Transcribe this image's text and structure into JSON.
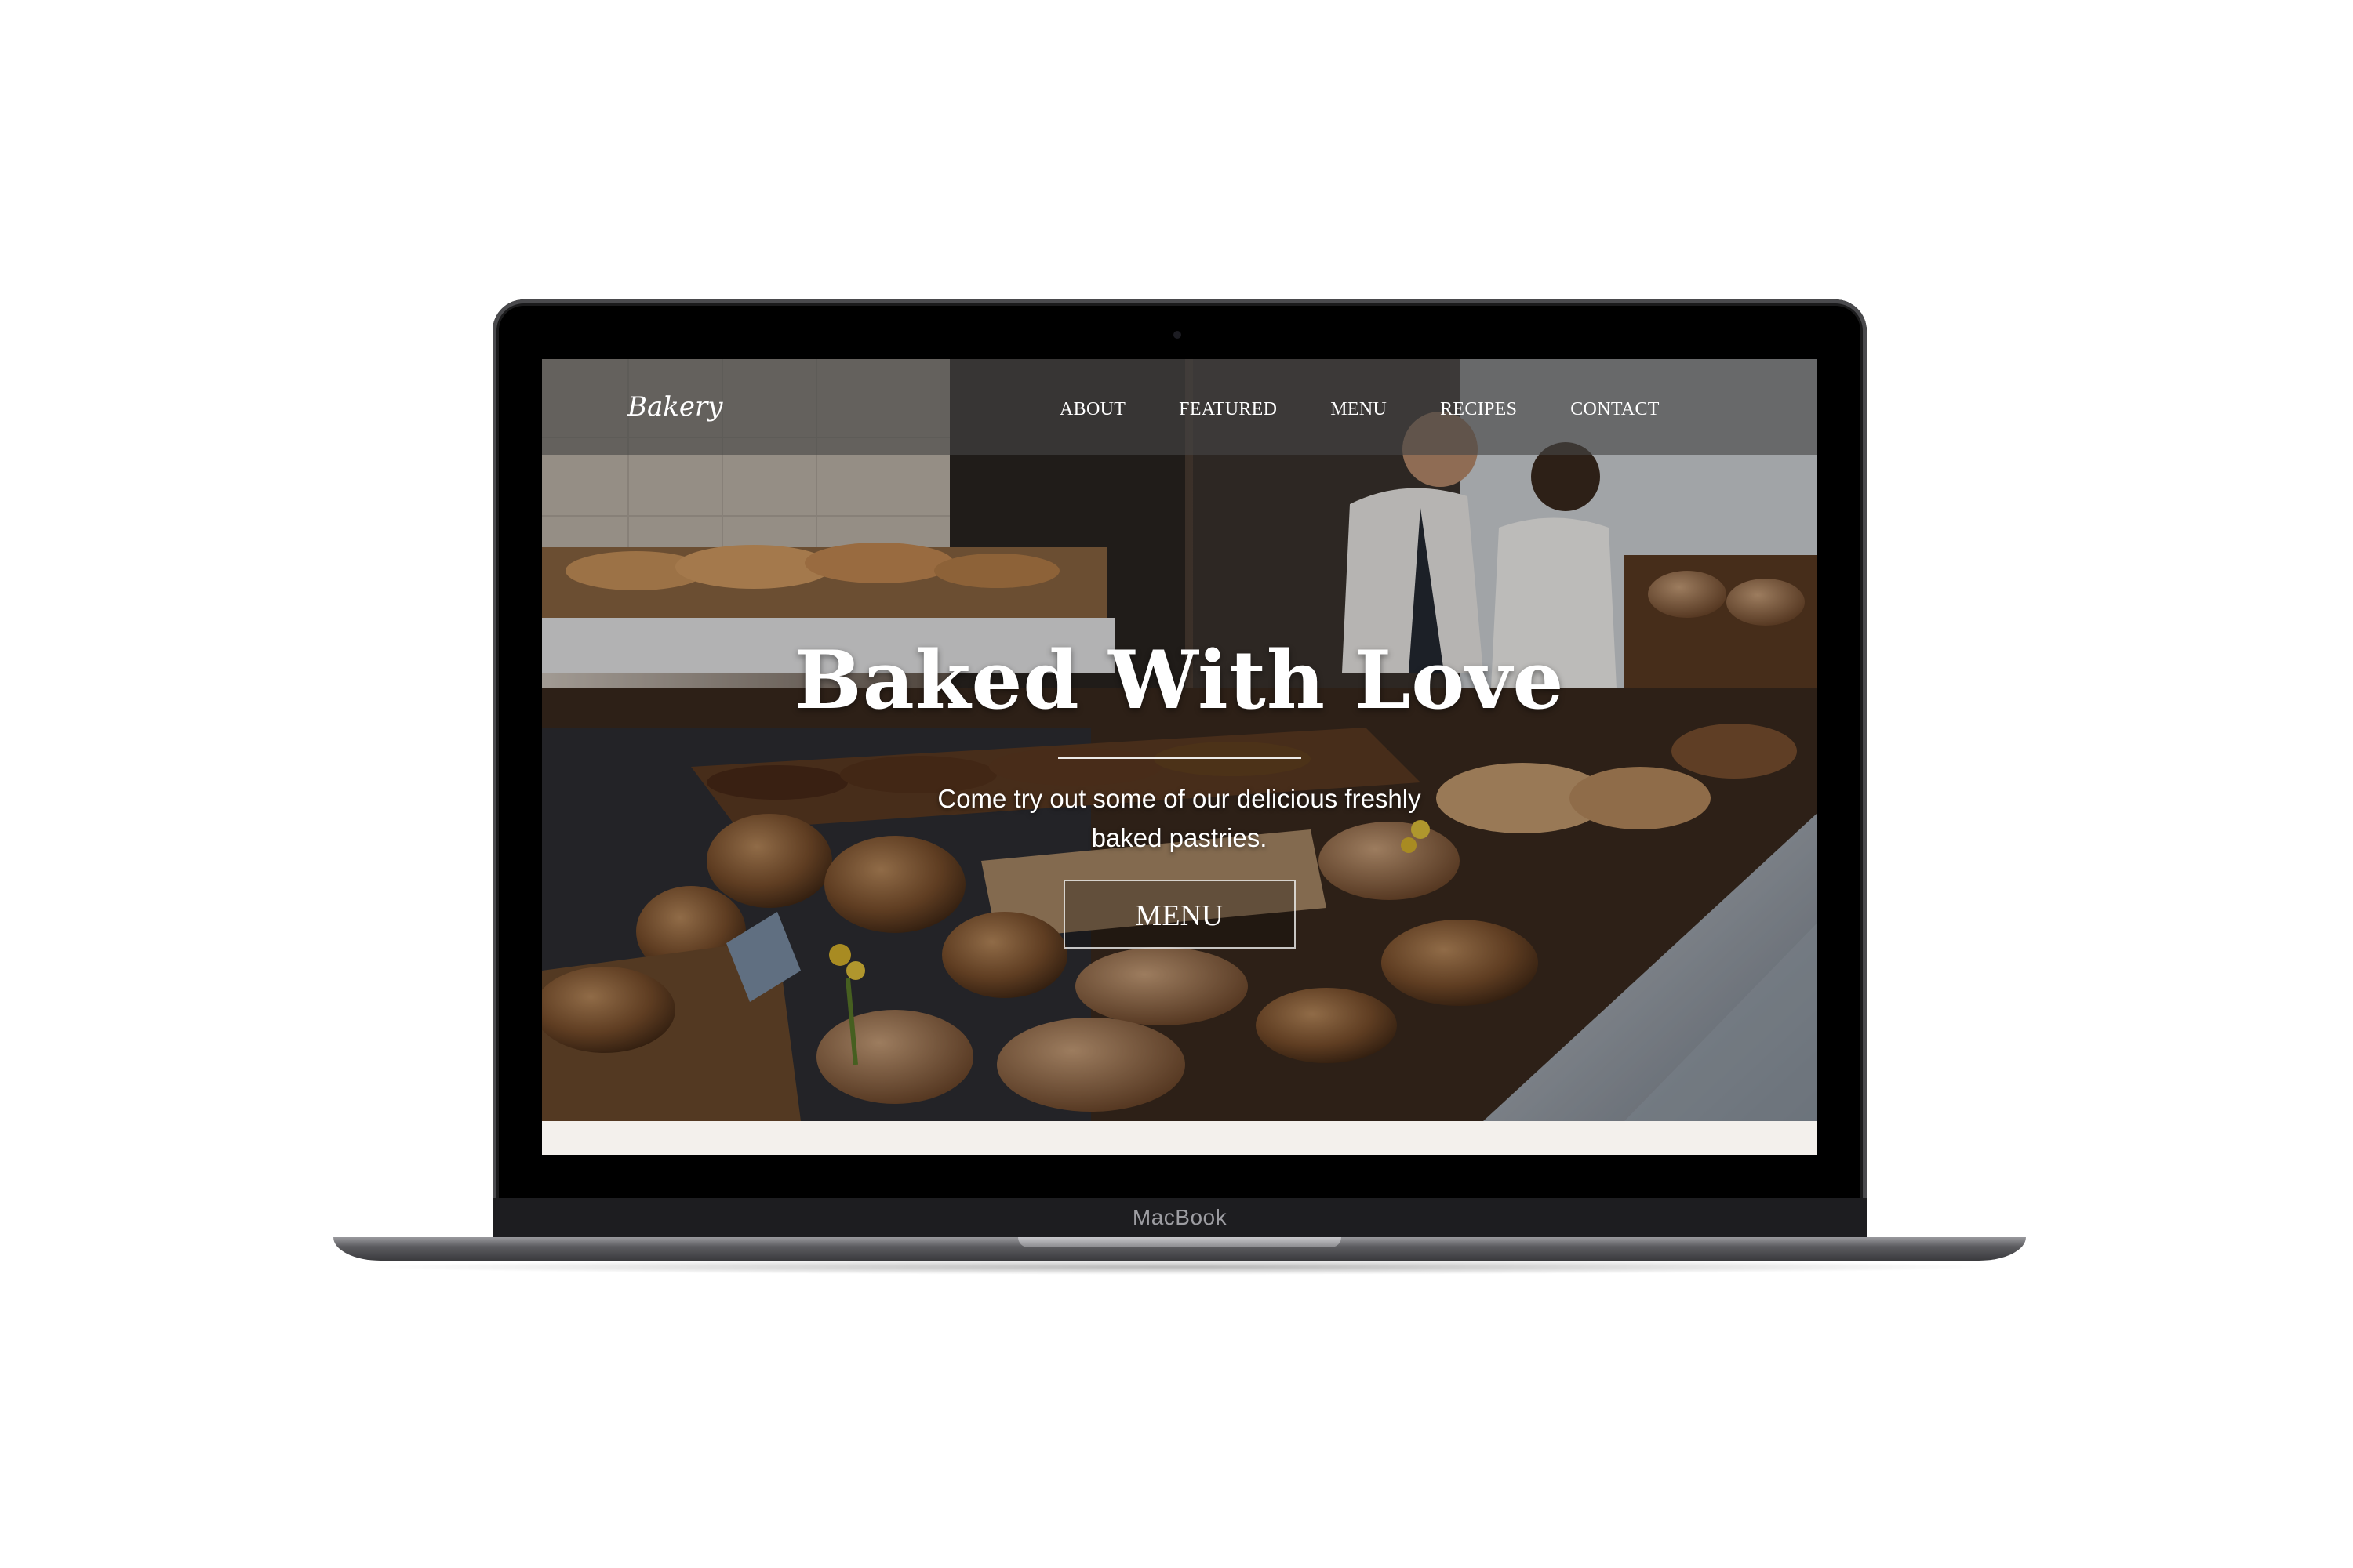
{
  "device": {
    "label": "MacBook"
  },
  "site": {
    "brand": "Bakery",
    "nav": [
      {
        "label": "ABOUT"
      },
      {
        "label": "FEATURED"
      },
      {
        "label": "MENU"
      },
      {
        "label": "RECIPES"
      },
      {
        "label": "CONTACT"
      }
    ],
    "hero": {
      "title": "Baked With Love",
      "subtitle": "Come try out some of our delicious freshly baked pastries.",
      "button_label": "MENU",
      "image": "bakery-display-photo"
    }
  },
  "colors": {
    "navbar": "#464646",
    "text": "#ffffff",
    "page_background": "#f3f0ec"
  }
}
